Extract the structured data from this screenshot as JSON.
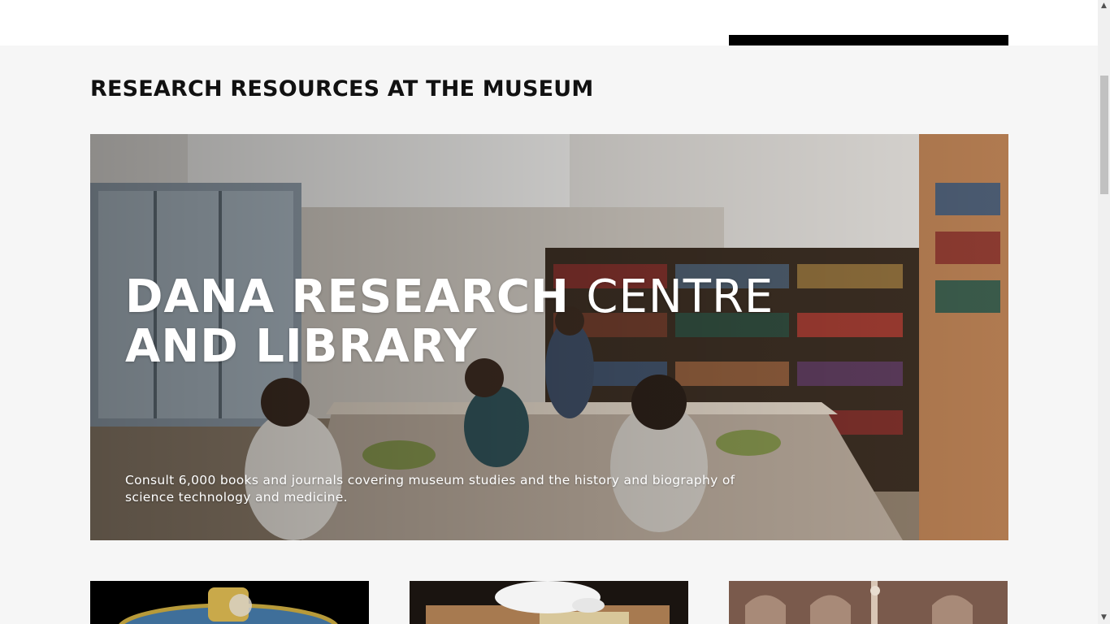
{
  "section": {
    "title": "RESEARCH RESOURCES AT THE MUSEUM"
  },
  "hero": {
    "title_line1_bold": "DANA RESEARCH",
    "title_line1_light": "CENTRE",
    "title_line2": "AND LIBRARY",
    "description": "Consult 6,000 books and journals covering museum studies and the history and biography of science technology and medicine."
  },
  "cards": [
    {
      "image": "orrery-image"
    },
    {
      "image": "rare-book-image"
    },
    {
      "image": "historic-building-image"
    }
  ],
  "scrollbar": {
    "up_icon": "▲",
    "down_icon": "▼"
  },
  "colors": {
    "page_background": "#f6f6f6",
    "text": "#111111",
    "hero_text": "#ffffff"
  }
}
